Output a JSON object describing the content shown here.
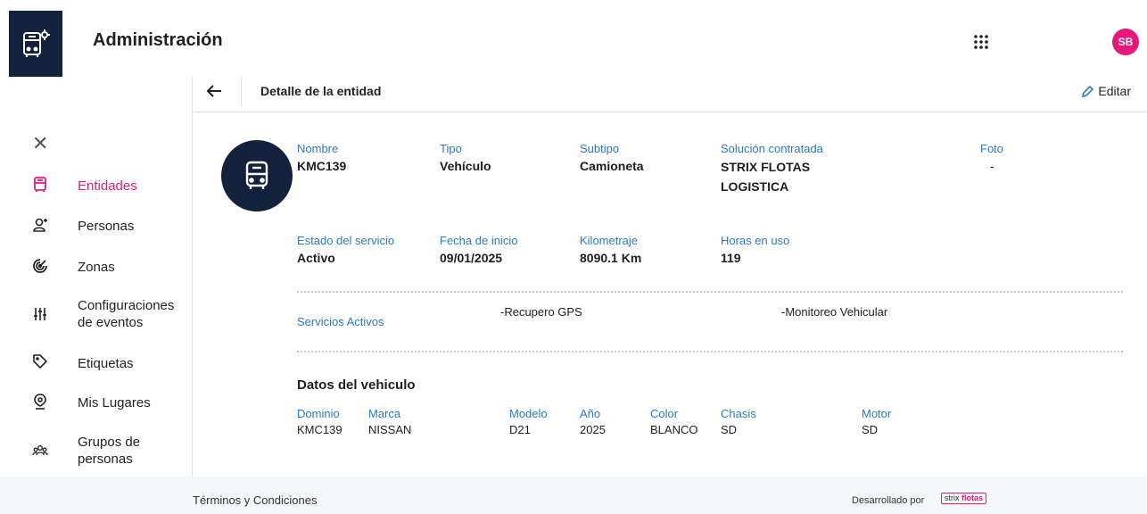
{
  "app": {
    "title": "Administración",
    "user_initials": "SB"
  },
  "sidebar": {
    "items": [
      {
        "label": "Entidades",
        "icon": "truck-icon",
        "active": true
      },
      {
        "label": "Personas",
        "icon": "person-add-icon"
      },
      {
        "label": "Zonas",
        "icon": "radar-icon"
      },
      {
        "label": "Configuraciones de eventos",
        "icon": "sliders-icon"
      },
      {
        "label": "Etiquetas",
        "icon": "tag-icon"
      },
      {
        "label": "Mis Lugares",
        "icon": "map-pin-icon"
      },
      {
        "label": "Grupos de personas",
        "icon": "group-icon"
      }
    ]
  },
  "header": {
    "title": "Detalle de la entidad",
    "edit_label": "Editar"
  },
  "entity": {
    "nombre": {
      "label": "Nombre",
      "value": "KMC139"
    },
    "tipo": {
      "label": "Tipo",
      "value": "Vehículo"
    },
    "subtipo": {
      "label": "Subtipo",
      "value": "Camioneta"
    },
    "solucion": {
      "label": "Solución contratada",
      "value": "STRIX FLOTAS LOGISTICA"
    },
    "foto": {
      "label": "Foto",
      "value": "-"
    },
    "estado": {
      "label": "Estado del servicio",
      "value": "Activo"
    },
    "fecha": {
      "label": "Fecha de inicio",
      "value": "09/01/2025"
    },
    "km": {
      "label": "Kilometraje",
      "value": "8090.1 Km"
    },
    "horas": {
      "label": "Horas en uso",
      "value": "119"
    }
  },
  "services": {
    "label": "Servicios Activos",
    "items": [
      "-Recupero GPS",
      "-Monitoreo Vehicular"
    ]
  },
  "vehicle": {
    "title": "Datos del vehiculo",
    "dominio": {
      "label": "Dominio",
      "value": "KMC139"
    },
    "marca": {
      "label": "Marca",
      "value": "NISSAN"
    },
    "modelo": {
      "label": "Modelo",
      "value": "D21"
    },
    "anio": {
      "label": "Año",
      "value": "2025"
    },
    "color": {
      "label": "Color",
      "value": "BLANCO"
    },
    "chasis": {
      "label": "Chasis",
      "value": "SD"
    },
    "motor": {
      "label": "Motor",
      "value": "SD"
    }
  },
  "footer": {
    "terms": "Términos y Condiciones",
    "developed_by": "Desarrollado por",
    "brand_a": "strix",
    "brand_b": "flotas"
  }
}
